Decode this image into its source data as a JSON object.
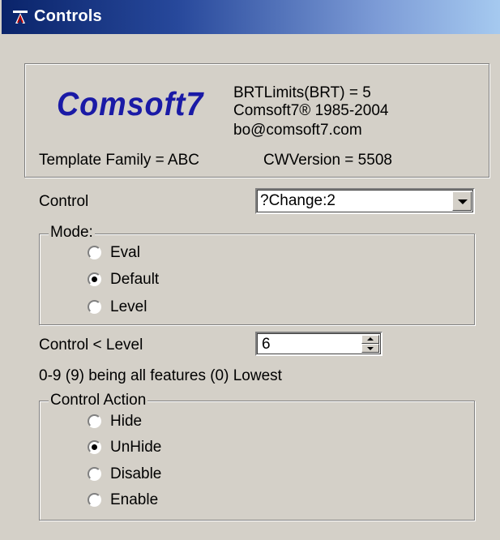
{
  "window": {
    "title": "Controls"
  },
  "info": {
    "logo_text": "Comsoft7",
    "brt_limits": "BRTLimits(BRT) = 5",
    "copyright": "Comsoft7® 1985-2004",
    "email": "bo@comsoft7.com",
    "template_family": "Template Family = ABC",
    "cw_version": "CWVersion = 5508"
  },
  "control": {
    "label": "Control",
    "selected": "?Change:2"
  },
  "mode": {
    "legend": "Mode:",
    "options": [
      {
        "label": "Eval",
        "checked": false
      },
      {
        "label": "Default",
        "checked": false
      },
      {
        "label": "Level",
        "checked": true
      }
    ]
  },
  "level": {
    "label": "Control < Level",
    "value": "6",
    "hint": "0-9 (9) being all features (0) Lowest"
  },
  "control_action": {
    "legend": "Control Action",
    "options": [
      {
        "label": "Hide",
        "checked": false
      },
      {
        "label": "UnHide",
        "checked": false
      },
      {
        "label": "Disable",
        "checked": true
      },
      {
        "label": "Enable",
        "checked": false
      }
    ]
  },
  "colors": {
    "face": "#d4d0c8",
    "title_start": "#0a246a",
    "title_end": "#a6caf0",
    "logo": "#1a1aa6"
  }
}
